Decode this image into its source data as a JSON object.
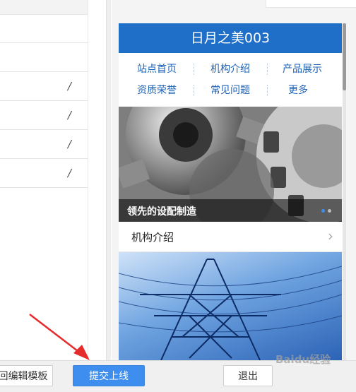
{
  "preview": {
    "site_title": "日月之美003",
    "nav": [
      "站点首页",
      "机构介绍",
      "产品展示",
      "资质荣誉",
      "常见问题",
      "更多"
    ],
    "banner_caption": "领先的设配制造",
    "section_label": "机构介绍"
  },
  "actions": {
    "back_edit": "回编辑模板",
    "submit": "提交上线",
    "exit": "退出"
  },
  "watermark": "Baidu经验",
  "colors": {
    "header": "#1f6fc9",
    "nav_text": "#1d62b5",
    "submit_button": "#3e8ef0",
    "annotation_arrow": "#e52b2b"
  },
  "icons": {
    "edit": "pencil-icon",
    "chevron": "chevron-right-icon",
    "carousel": "carousel-dots"
  }
}
